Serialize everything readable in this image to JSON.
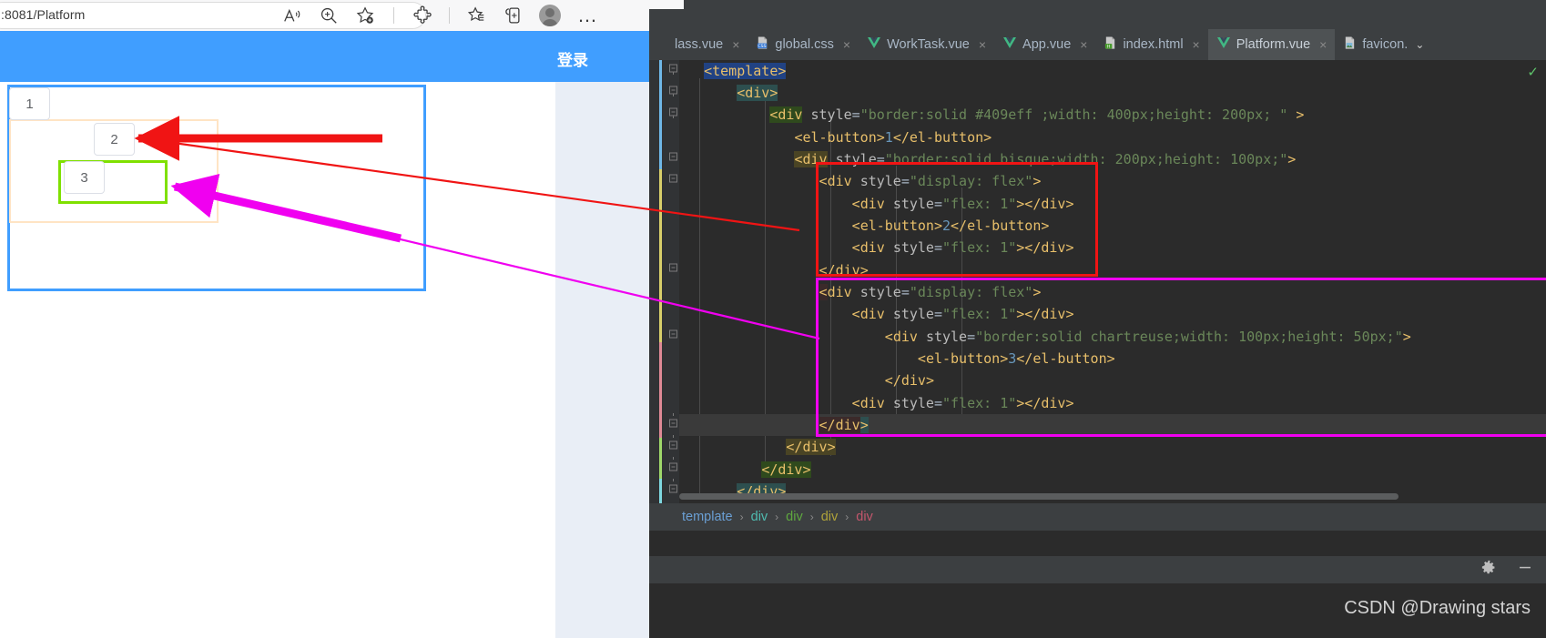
{
  "browser": {
    "address_value": ":8081/Platform",
    "icons": [
      {
        "name": "read-aloud-icon",
        "glyph": "A"
      },
      {
        "name": "zoom-icon",
        "glyph": "search"
      },
      {
        "name": "add-favorite-icon",
        "glyph": "star-plus"
      },
      {
        "name": "extension-puzzle-icon",
        "glyph": "puzzle"
      },
      {
        "name": "favorites-icon",
        "glyph": "star-lines"
      },
      {
        "name": "collections-icon",
        "glyph": "collections"
      },
      {
        "name": "profile-avatar",
        "glyph": "person"
      },
      {
        "name": "more-settings-icon",
        "glyph": "…"
      }
    ]
  },
  "page": {
    "header_login": "登录",
    "header_color": "#409eff",
    "buttons": {
      "b1": "1",
      "b2": "2",
      "b3": "3"
    },
    "boxes": {
      "outer_color": "#409eff",
      "middle_color": "bisque",
      "inner_color": "chartreuse"
    }
  },
  "ide": {
    "tabs": [
      {
        "label": "lass.vue",
        "icon": "vue-file-icon",
        "close": "×",
        "active": false
      },
      {
        "label": "global.css",
        "icon": "css-file-icon",
        "close": "×",
        "active": false
      },
      {
        "label": "WorkTask.vue",
        "icon": "vue-file-icon",
        "close": "×",
        "active": false
      },
      {
        "label": "App.vue",
        "icon": "vue-file-icon",
        "close": "×",
        "active": false
      },
      {
        "label": "index.html",
        "icon": "html-file-icon",
        "close": "×",
        "active": false
      },
      {
        "label": "Platform.vue",
        "icon": "vue-file-icon",
        "close": "×",
        "active": true
      },
      {
        "label": "favicon.",
        "icon": "image-file-icon",
        "close": "",
        "active": false
      }
    ],
    "tab_overflow_chevron": "⌄",
    "inspection_ok": "✓",
    "breadcrumb": [
      {
        "label": "template",
        "color": "#6a9fd4"
      },
      {
        "label": "div",
        "color": "#4fbcb0"
      },
      {
        "label": "div",
        "color": "#5fa83f"
      },
      {
        "label": "div",
        "color": "#b0a33a"
      },
      {
        "label": "div",
        "color": "#c3566c"
      }
    ],
    "breadcrumb_separator": "›",
    "status_icons": [
      {
        "name": "settings-gear-icon",
        "glyph": "⚙"
      },
      {
        "name": "minimize-icon",
        "glyph": "—"
      }
    ],
    "code_lines": [
      "<template>",
      "    <div>",
      "        <div style=\"border:solid #409eff ;width: 400px;height: 200px; \" >",
      "            <el-button>1</el-button>",
      "            <div style=\"border:solid bisque;width: 200px;height: 100px;\">",
      "                <div style=\"display: flex\">",
      "                    <div style=\"flex: 1\"></div>",
      "                    <el-button>2</el-button>",
      "                    <div style=\"flex: 1\"></div>",
      "                </div>",
      "                <div style=\"display: flex\">",
      "                    <div style=\"flex: 1\"></div>",
      "                        <div style=\"border:solid chartreuse;width: 100px;height: 50px;\">",
      "                            <el-button>3</el-button>",
      "                        </div>",
      "                    <div style=\"flex: 1\"></div>",
      "                </div>",
      "            </div>",
      "        </div>",
      "    </div>"
    ]
  },
  "watermark": {
    "text": "CSDN @Drawing stars"
  },
  "annotations": {
    "red_box_label": "flex-row-2-highlight",
    "magenta_box_label": "flex-row-3-highlight",
    "red_color": "#f01414",
    "magenta_color": "#f000f0"
  }
}
